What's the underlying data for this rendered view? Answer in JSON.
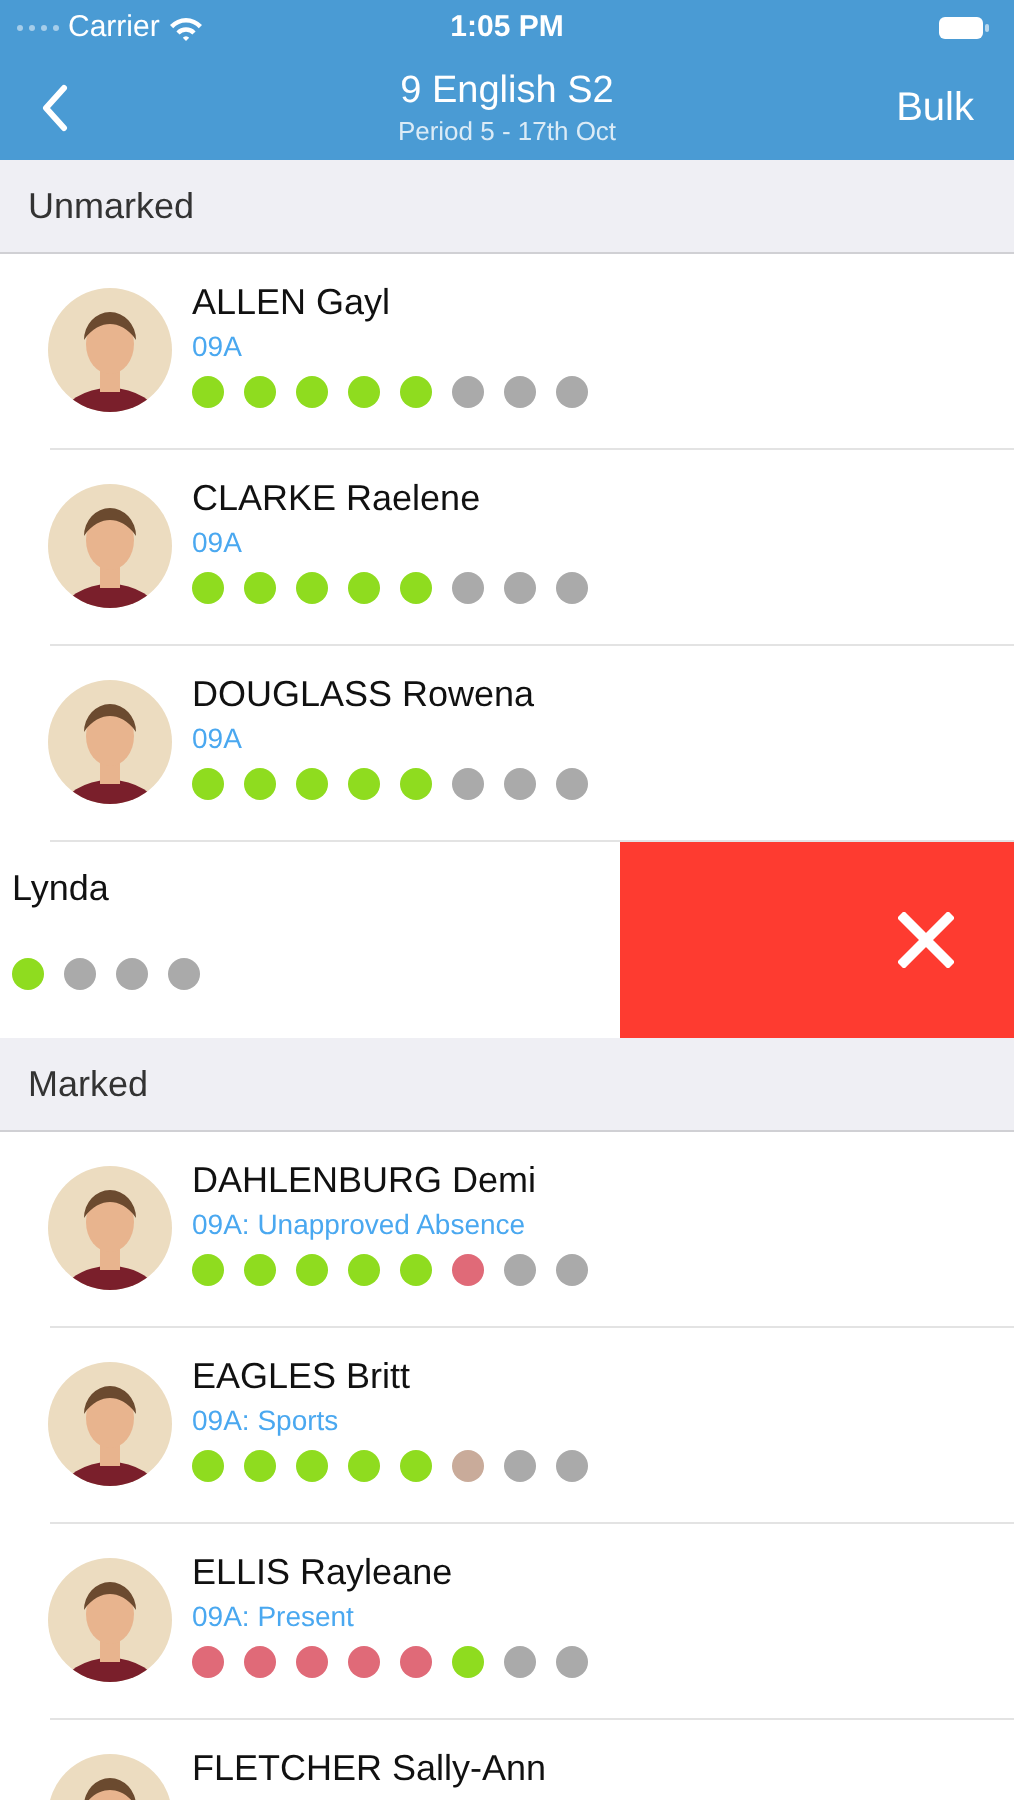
{
  "status_bar": {
    "carrier": "Carrier",
    "time": "1:05 PM"
  },
  "nav": {
    "title": "9 English S2",
    "subtitle": "Period 5 - 17th Oct",
    "action": "Bulk"
  },
  "sections": [
    {
      "title": "Unmarked",
      "students": [
        {
          "kind": "normal",
          "name": "ALLEN Gayl",
          "detail": "09A",
          "dots": [
            {
              "color": "#8fdc1f"
            },
            {
              "color": "#8fdc1f"
            },
            {
              "color": "#8fdc1f"
            },
            {
              "color": "#8fdc1f"
            },
            {
              "color": "#8fdc1f"
            },
            {
              "color": "#aaaaaa"
            },
            {
              "color": "#aaaaaa"
            },
            {
              "color": "#aaaaaa"
            }
          ]
        },
        {
          "kind": "normal",
          "name": "CLARKE Raelene",
          "detail": "09A",
          "dots": [
            {
              "color": "#8fdc1f"
            },
            {
              "color": "#8fdc1f"
            },
            {
              "color": "#8fdc1f"
            },
            {
              "color": "#8fdc1f"
            },
            {
              "color": "#8fdc1f"
            },
            {
              "color": "#aaaaaa"
            },
            {
              "color": "#aaaaaa"
            },
            {
              "color": "#aaaaaa"
            }
          ]
        },
        {
          "kind": "normal",
          "name": "DOUGLASS Rowena",
          "detail": "09A",
          "dots": [
            {
              "color": "#8fdc1f"
            },
            {
              "color": "#8fdc1f"
            },
            {
              "color": "#8fdc1f"
            },
            {
              "color": "#8fdc1f"
            },
            {
              "color": "#8fdc1f"
            },
            {
              "color": "#aaaaaa"
            },
            {
              "color": "#aaaaaa"
            },
            {
              "color": "#aaaaaa"
            }
          ]
        },
        {
          "kind": "swiped",
          "name": "Lynda",
          "dots": [
            {
              "color": "#8fdc1f"
            },
            {
              "color": "#aaaaaa"
            },
            {
              "color": "#aaaaaa"
            },
            {
              "color": "#aaaaaa"
            }
          ]
        }
      ]
    },
    {
      "title": "Marked",
      "students": [
        {
          "kind": "normal",
          "name": "DAHLENBURG Demi",
          "detail": "09A: Unapproved Absence",
          "dots": [
            {
              "color": "#8fdc1f"
            },
            {
              "color": "#8fdc1f"
            },
            {
              "color": "#8fdc1f"
            },
            {
              "color": "#8fdc1f"
            },
            {
              "color": "#8fdc1f"
            },
            {
              "color": "#e06a78"
            },
            {
              "color": "#aaaaaa"
            },
            {
              "color": "#aaaaaa"
            }
          ]
        },
        {
          "kind": "normal",
          "name": "EAGLES Britt",
          "detail": "09A: Sports",
          "dots": [
            {
              "color": "#8fdc1f"
            },
            {
              "color": "#8fdc1f"
            },
            {
              "color": "#8fdc1f"
            },
            {
              "color": "#8fdc1f"
            },
            {
              "color": "#8fdc1f"
            },
            {
              "color": "#c9ab9a"
            },
            {
              "color": "#aaaaaa"
            },
            {
              "color": "#aaaaaa"
            }
          ]
        },
        {
          "kind": "normal",
          "name": "ELLIS Rayleane",
          "detail": "09A: Present",
          "dots": [
            {
              "color": "#e06a78"
            },
            {
              "color": "#e06a78"
            },
            {
              "color": "#e06a78"
            },
            {
              "color": "#e06a78"
            },
            {
              "color": "#e06a78"
            },
            {
              "color": "#8fdc1f"
            },
            {
              "color": "#aaaaaa"
            },
            {
              "color": "#aaaaaa"
            }
          ]
        },
        {
          "kind": "normal",
          "name": "FLETCHER Sally-Ann"
        }
      ]
    }
  ]
}
